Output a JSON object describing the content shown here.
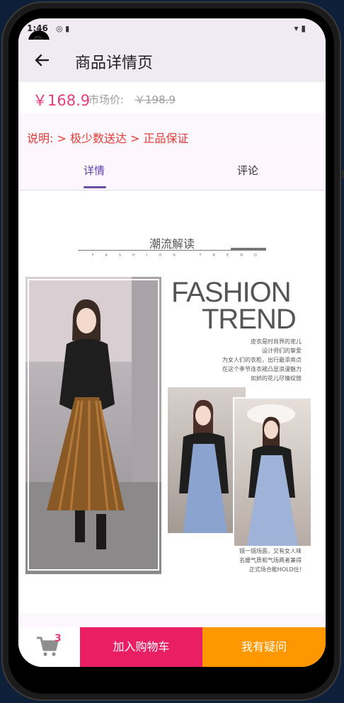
{
  "status": {
    "time": "1:46",
    "left_icons": "◎ ▮",
    "right_icons": "▾ ▮"
  },
  "header": {
    "title": "商品详情页"
  },
  "price": {
    "current": "￥168.9",
    "market_label": "市场价:",
    "market_value": "￥198.9"
  },
  "description": "说明: > 极少数送达 > 正品保证",
  "tabs": [
    {
      "label": "详情"
    },
    {
      "label": "评论"
    }
  ],
  "detail": {
    "section_title": "潮流解读",
    "section_subtitle": "FASHION TREND",
    "fashion_line1": "FASHION",
    "fashion_line2": "TREND",
    "intro_lines": [
      "皮衣是时尚界的宠儿",
      "设计师们的挚爱",
      "为女人们的衣柜，出行最添亮点",
      "在这个季节连衣裙凸显浪漫魅力",
      "如娇的花儿尽情绽放"
    ],
    "caption_lines": [
      "镜一镜场面，又有女人味",
      "名媛气质和气场两者兼得",
      "正式场合能HOLD住!"
    ]
  },
  "bottom": {
    "cart_count": "3",
    "add_to_cart": "加入购物车",
    "ask": "我有疑问"
  },
  "colors": {
    "accent": "#e63d7c",
    "tab_active": "#6750a4",
    "add_cart_bg": "#e91e63",
    "ask_bg": "#ff9800",
    "desc": "#e53935"
  }
}
